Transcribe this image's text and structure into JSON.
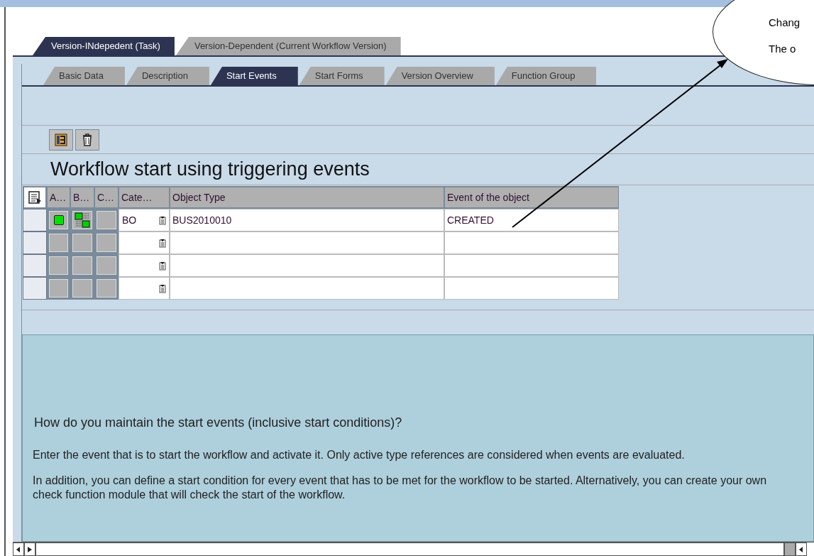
{
  "outer_tabs": [
    {
      "label": "Version-INdepedent (Task)",
      "selected": true
    },
    {
      "label": "Version-Dependent (Current Workflow Version)",
      "selected": false
    }
  ],
  "inner_tabs": [
    {
      "label": "Basic Data",
      "selected": false
    },
    {
      "label": "Description",
      "selected": false
    },
    {
      "label": "Start Events",
      "selected": true
    },
    {
      "label": "Start Forms",
      "selected": false
    },
    {
      "label": "Version Overview",
      "selected": false
    },
    {
      "label": "Function Group",
      "selected": false
    }
  ],
  "section_title": "Workflow start using triggering events",
  "table": {
    "columns": [
      "A…",
      "B…",
      "C…",
      "Cate…",
      "Object Type",
      "Event of the object"
    ],
    "rows": [
      {
        "active": true,
        "linked": true,
        "category": "BO",
        "object_type": "BUS2010010",
        "event": "CREATED"
      },
      {
        "active": false,
        "linked": false,
        "category": "",
        "object_type": "",
        "event": ""
      },
      {
        "active": false,
        "linked": false,
        "category": "",
        "object_type": "",
        "event": ""
      },
      {
        "active": false,
        "linked": false,
        "category": "",
        "object_type": "",
        "event": ""
      }
    ]
  },
  "help": {
    "title": "How do you maintain the start events (inclusive start conditions)?",
    "paragraphs": [
      "Enter the event that is to start the workflow and activate it. Only active type references are considered when events are evaluated.",
      "In addition, you can define a start condition for every event that has to be met for the workflow to be started. Alternatively, you can create your own check function module that will check the start of the workflow."
    ]
  },
  "callout": {
    "lines": [
      "Chang",
      "The o"
    ]
  }
}
